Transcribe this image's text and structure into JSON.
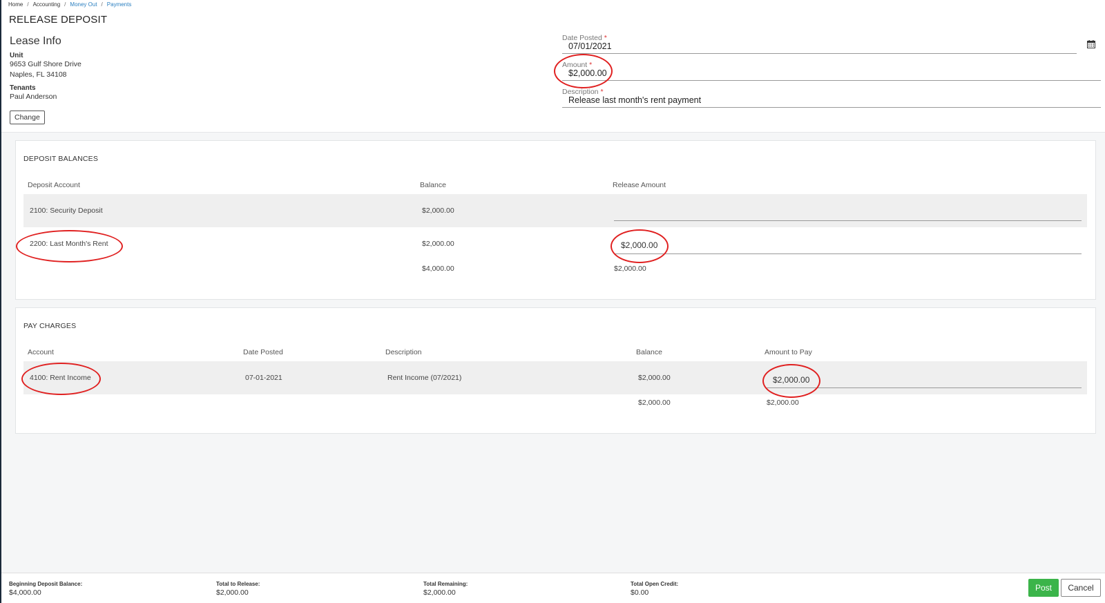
{
  "breadcrumb": [
    "Home",
    "Accounting",
    "Money Out",
    "Payments"
  ],
  "page_title": "RELEASE DEPOSIT",
  "lease_info": {
    "heading": "Lease Info",
    "unit_label": "Unit",
    "unit_line1": "9653 Gulf Shore Drive",
    "unit_line2": "Naples, FL 34108",
    "tenants_label": "Tenants",
    "tenant_name": "Paul Anderson",
    "change_label": "Change"
  },
  "form": {
    "date_label": "Date Posted",
    "date_value": "07/01/2021",
    "amount_label": "Amount",
    "amount_value": "$2,000.00",
    "description_label": "Description",
    "description_value": "Release last month's rent payment",
    "required_mark": "*"
  },
  "deposit_balances": {
    "title": "DEPOSIT BALANCES",
    "headers": [
      "Deposit Account",
      "Balance",
      "Release Amount"
    ],
    "rows": [
      {
        "account": "2100: Security Deposit",
        "balance": "$2,000.00",
        "release": ""
      },
      {
        "account": "2200: Last Month's Rent",
        "balance": "$2,000.00",
        "release": "$2,000.00"
      }
    ],
    "total_balance": "$4,000.00",
    "total_release": "$2,000.00"
  },
  "pay_charges": {
    "title": "PAY CHARGES",
    "headers": [
      "Account",
      "Date Posted",
      "Description",
      "Balance",
      "Amount to Pay"
    ],
    "rows": [
      {
        "account": "4100: Rent Income",
        "date": "07-01-2021",
        "description": "Rent Income (07/2021)",
        "balance": "$2,000.00",
        "amount": "$2,000.00"
      }
    ],
    "total_balance": "$2,000.00",
    "total_amount": "$2,000.00"
  },
  "footer": {
    "beginning_label": "Beginning Deposit Balance:",
    "beginning_value": "$4,000.00",
    "release_label": "Total to Release:",
    "release_value": "$2,000.00",
    "remaining_label": "Total Remaining:",
    "remaining_value": "$2,000.00",
    "credit_label": "Total Open Credit:",
    "credit_value": "$0.00",
    "post_label": "Post",
    "cancel_label": "Cancel"
  },
  "colors": {
    "accent_green": "#3bb44a",
    "link_blue": "#2a7fc0",
    "annotation_red": "#e02020"
  },
  "icons": {
    "date_picker": "calendar-icon"
  }
}
